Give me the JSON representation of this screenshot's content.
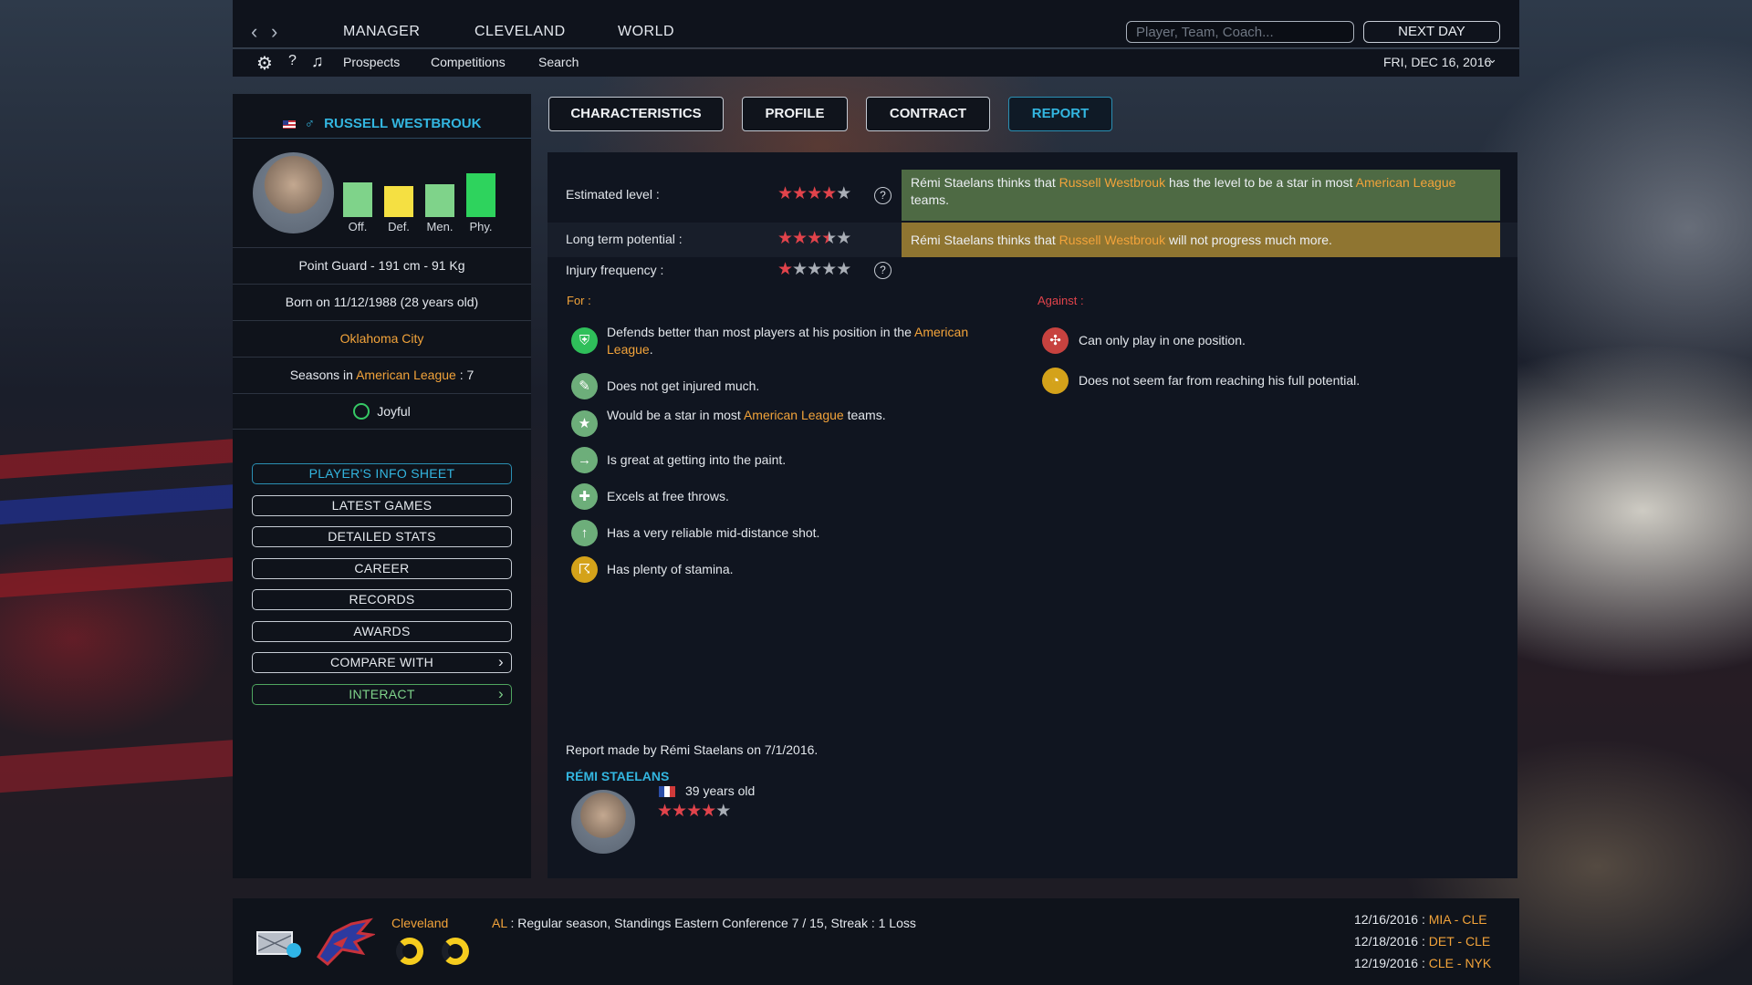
{
  "nav": {
    "back_icon": "chevron-left-icon",
    "forward_icon": "chevron-right-icon",
    "manager": "MANAGER",
    "team": "CLEVELAND",
    "world": "WORLD",
    "search_placeholder": "Player, Team, Coach...",
    "next_day": "NEXT DAY"
  },
  "subnav": {
    "help": "?",
    "prospects": "Prospects",
    "competitions": "Competitions",
    "search": "Search",
    "date": "FRI, DEC 16, 2016"
  },
  "player": {
    "name": "RUSSELL WESTBROUK",
    "ratings": [
      {
        "label": "Off.",
        "value": 0.65,
        "color": "#7fd38a"
      },
      {
        "label": "Def.",
        "value": 0.58,
        "color": "#f5e042"
      },
      {
        "label": "Men.",
        "value": 0.62,
        "color": "#7fd38a"
      },
      {
        "label": "Phy.",
        "value": 0.83,
        "color": "#2ed35d"
      }
    ],
    "position": "Point Guard - 191 cm - 91 Kg",
    "born": "Born on 11/12/1988 (28 years old)",
    "city": "Oklahoma City",
    "seasons_prefix": "Seasons in ",
    "league": "American League",
    "seasons_suffix": " : 7",
    "mood": "Joyful"
  },
  "side_buttons": [
    "PLAYER'S INFO SHEET",
    "LATEST GAMES",
    "DETAILED STATS",
    "CAREER",
    "RECORDS",
    "AWARDS",
    "COMPARE WITH",
    "INTERACT"
  ],
  "tabs": [
    "CHARACTERISTICS",
    "PROFILE",
    "CONTRACT",
    "REPORT"
  ],
  "report": {
    "estimated_label": "Estimated level :",
    "estimated_stars": 4,
    "potential_label": "Long term potential :",
    "potential_stars": 3.5,
    "injury_label": "Injury frequency :",
    "injury_stars": 1,
    "scout": "Rémi Staelans",
    "thinks": " thinks that ",
    "player": "Russell Westbrouk",
    "note1_mid": " has the level to be a star in most ",
    "league": "American League",
    "note1_end": "teams.",
    "note2_end": " will not progress much more.",
    "for_label": "For :",
    "against_label": "Against :",
    "for_items": [
      {
        "text": "Defends better than most players at his position in the ",
        "hl": "American",
        "text2": "League",
        "after": ".",
        "icon": "shield-icon",
        "color": "#2fbf5a"
      },
      {
        "text": "Does not get injured much.",
        "icon": "bandage-icon",
        "color": "#6dae7a"
      },
      {
        "text": "Would be a star in most ",
        "hl": "American League",
        "after": " teams.",
        "icon": "star-icon",
        "color": "#6dae7a"
      },
      {
        "text": "Is great at getting into the paint.",
        "icon": "arrow-icon",
        "color": "#6dae7a"
      },
      {
        "text": "Excels at free throws.",
        "icon": "throw-icon",
        "color": "#6dae7a"
      },
      {
        "text": "Has a very reliable mid-distance shot.",
        "icon": "shot-icon",
        "color": "#6dae7a"
      },
      {
        "text": "Has plenty of stamina.",
        "icon": "runner-icon",
        "color": "#d4a21a"
      }
    ],
    "against_items": [
      {
        "text": "Can only play in one position.",
        "icon": "position-icon",
        "color": "#c7423f"
      },
      {
        "text": "Does not seem far from reaching his full potential.",
        "icon": "gauge-icon",
        "color": "#d4a21a"
      }
    ],
    "made_by": "Report made by Rémi Staelans on 7/1/2016.",
    "scout_name": "RÉMI STAELANS",
    "scout_age": "39 years old",
    "scout_stars": 4
  },
  "bottom": {
    "team": "Cleveland",
    "league_abbr": "AL",
    "status": " : Regular season, Standings Eastern Conference 7 / 15, Streak : 1 Loss",
    "games": [
      {
        "date": "12/16/2016 : ",
        "home": "MIA",
        "sep": " - ",
        "away": "CLE"
      },
      {
        "date": "12/18/2016 : ",
        "home": "DET",
        "sep": " - ",
        "away": "CLE"
      },
      {
        "date": "12/19/2016 : ",
        "home": "CLE",
        "sep": " - ",
        "away": "NYK"
      }
    ]
  }
}
